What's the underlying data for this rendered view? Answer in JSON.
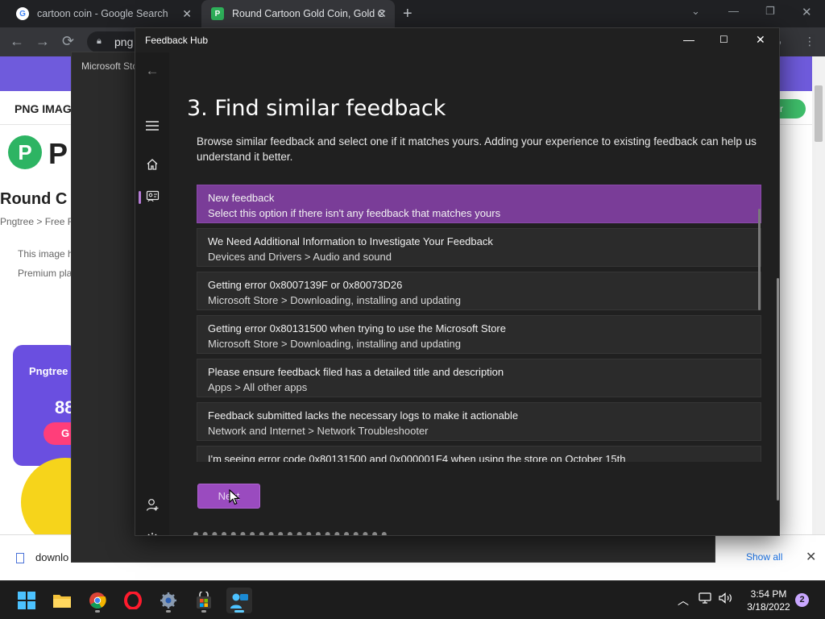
{
  "chrome": {
    "tabs": [
      {
        "title": "cartoon coin - Google Search",
        "favicon": "G"
      },
      {
        "title": "Round Cartoon Gold Coin, Gold C",
        "favicon": "P"
      }
    ],
    "new_tab": "+",
    "omnibox_text": "png"
  },
  "web_page": {
    "nav_title": "PNG IMAG",
    "register": "ster",
    "logo_text": "P",
    "logo_letter": "P",
    "heading": "Round C",
    "breadcrumb": "Pngtree > Free F",
    "note_1": "This image h",
    "note_2": "Premium pla",
    "promo_title": "Pngtree",
    "promo_number": "88",
    "promo_button": "G"
  },
  "download_bar": {
    "file_label": "downlo",
    "show_all": "Show all"
  },
  "ms_store": {
    "title": "Microsoft Sto"
  },
  "feedback_hub": {
    "title": "Feedback Hub",
    "heading": "3. Find similar feedback",
    "description": "Browse similar feedback and select one if it matches yours. Adding your experience to existing feedback can help us understand it better.",
    "items": [
      {
        "title": "New feedback",
        "subtitle": "Select this option if there isn't any feedback that matches yours",
        "selected": true
      },
      {
        "title": "We Need Additional Information to Investigate Your Feedback",
        "subtitle": "Devices and Drivers > Audio and sound"
      },
      {
        "title": "Getting error 0x8007139F or 0x80073D26",
        "subtitle": "Microsoft Store > Downloading, installing and updating"
      },
      {
        "title": "Getting error 0x80131500 when trying to use the Microsoft Store",
        "subtitle": "Microsoft Store > Downloading, installing and updating"
      },
      {
        "title": "Please ensure feedback filed has a detailed title and description",
        "subtitle": "Apps > All other apps"
      },
      {
        "title": "Feedback submitted lacks the necessary logs to make it actionable",
        "subtitle": "Network and Internet > Network Troubleshooter"
      },
      {
        "title": "I'm seeing error code 0x80131500 and 0x000001F4 when using the store on October 15th",
        "subtitle": ""
      }
    ],
    "next_button": "Next",
    "accent_color": "#7a3d98"
  },
  "taskbar": {
    "apps": [
      "start-icon",
      "file-explorer-icon",
      "chrome-icon",
      "opera-icon",
      "settings-icon",
      "store-icon",
      "feedback-hub-icon"
    ],
    "time": "3:54 PM",
    "date": "3/18/2022",
    "notification_count": "2"
  }
}
